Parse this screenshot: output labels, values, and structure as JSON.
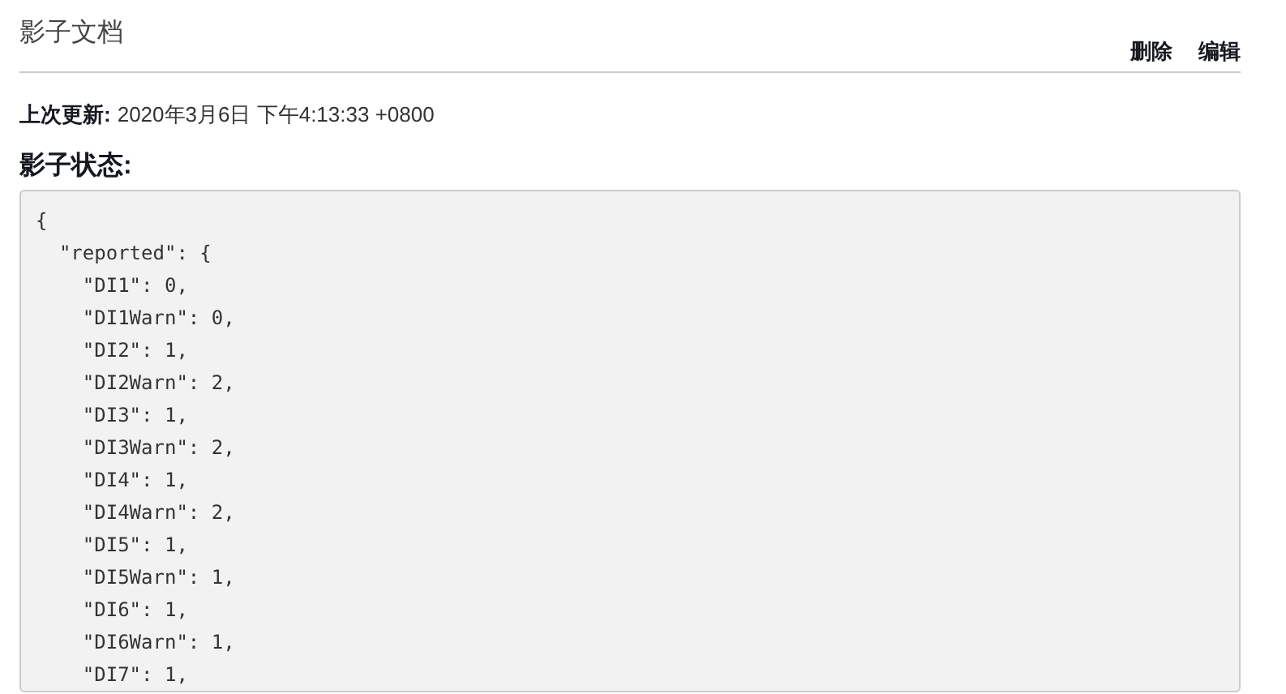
{
  "title": "影子文档",
  "actions": [
    "删除",
    "编辑"
  ],
  "last_updated": {
    "label": "上次更新:",
    "value": "2020年3月6日 下午4:13:33 +0800"
  },
  "state_heading": "影子状态:",
  "code_lines": [
    "{",
    "  \"reported\": {",
    "    \"DI1\": 0,",
    "    \"DI1Warn\": 0,",
    "    \"DI2\": 1,",
    "    \"DI2Warn\": 2,",
    "    \"DI3\": 1,",
    "    \"DI3Warn\": 2,",
    "    \"DI4\": 1,",
    "    \"DI4Warn\": 2,",
    "    \"DI5\": 1,",
    "    \"DI5Warn\": 1,",
    "    \"DI6\": 1,",
    "    \"DI6Warn\": 1,",
    "    \"DI7\": 1,"
  ]
}
